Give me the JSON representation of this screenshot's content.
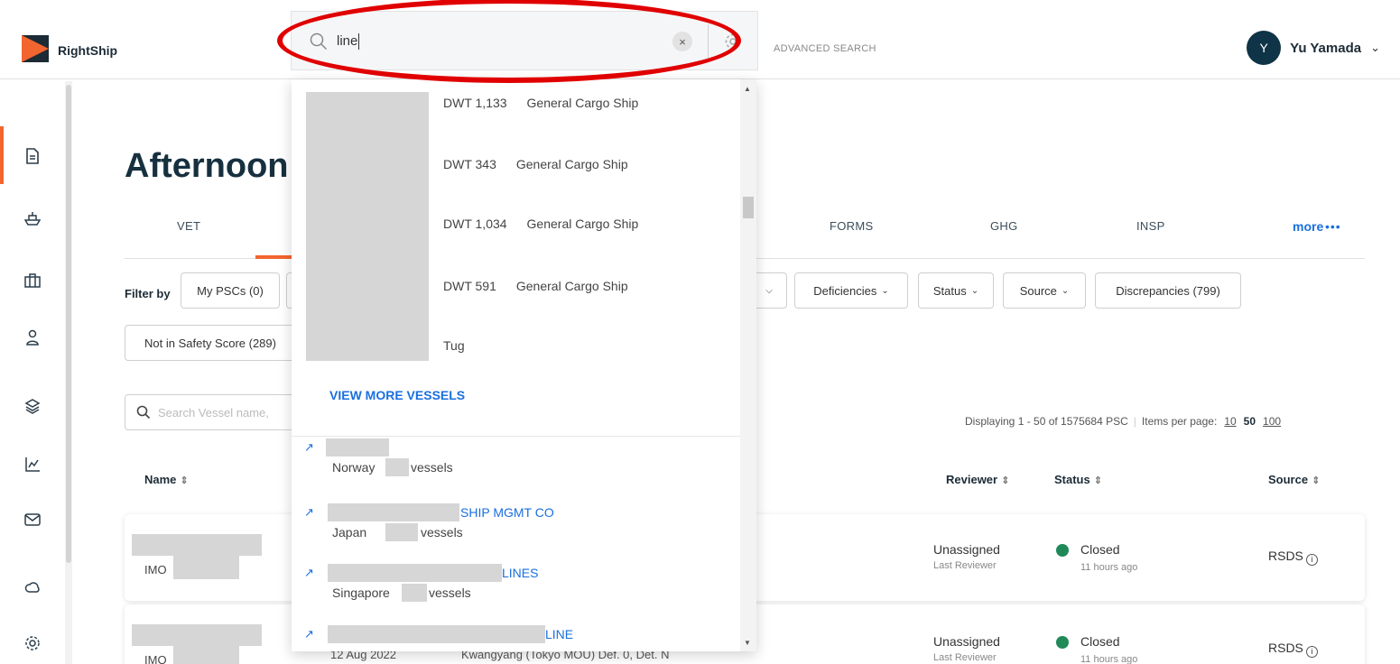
{
  "header": {
    "brand": "RightShip",
    "advanced_search": "ADVANCED SEARCH",
    "user": {
      "initial": "Y",
      "name": "Yu Yamada"
    }
  },
  "search": {
    "query": "line",
    "clear_symbol": "×"
  },
  "dropdown": {
    "vessels": [
      {
        "dwt": "DWT 1,133",
        "type": "General Cargo Ship"
      },
      {
        "dwt": "DWT 343",
        "type": "General Cargo Ship"
      },
      {
        "dwt": "DWT 1,034",
        "type": "General Cargo Ship"
      },
      {
        "dwt": "DWT 591",
        "type": "General Cargo Ship"
      },
      {
        "dwt": "",
        "type": "Tug"
      }
    ],
    "view_more": "VIEW MORE VESSELS",
    "companies": [
      {
        "name_suffix": "",
        "country": "Norway",
        "vessels_word": "vessels"
      },
      {
        "name_suffix": "SHIP MGMT CO",
        "country": "Japan",
        "vessels_word": "vessels"
      },
      {
        "name_suffix": "LINES",
        "country": "Singapore",
        "vessels_word": "vessels"
      },
      {
        "name_suffix": "LINE",
        "country": "",
        "vessels_word": ""
      }
    ]
  },
  "sidebar": {
    "icons": [
      "document-icon",
      "ship-icon",
      "briefcase-icon",
      "person-icon",
      "layers-icon",
      "chart-icon",
      "mail-icon",
      "cloud-icon",
      "settings-icon"
    ]
  },
  "page": {
    "greeting": "Afternoon",
    "tabs": [
      "VET",
      "FORMS",
      "GHG",
      "INSP"
    ],
    "more": "more",
    "more_dots": "•••",
    "filter_label": "Filter by",
    "filters": {
      "my_pscs": "My PSCs (0)",
      "deficiencies": "Deficiencies",
      "status": "Status",
      "source": "Source",
      "discrepancies": "Discrepancies (799)",
      "not_in_safety_score": "Not in Safety Score (289)"
    },
    "vessel_search_placeholder": "Search Vessel name,",
    "display_info": "Displaying 1 - 50 of 1575684 PSC",
    "items_per_page_label": "Items per page:",
    "items_per_page": [
      "10",
      "50",
      "100"
    ],
    "columns": {
      "name": "Name",
      "reviewer": "Reviewer",
      "status": "Status",
      "source": "Source"
    },
    "rows": [
      {
        "imo_prefix": "IMO",
        "date": "",
        "port": "",
        "reviewer": "Unassigned",
        "reviewer_sub": "Last Reviewer",
        "status": "Closed",
        "status_time": "11 hours ago",
        "source": "RSDS"
      },
      {
        "imo_prefix": "IMO",
        "date": "12 Aug 2022",
        "port": "Kwangyang (Tokyo MOU) Def. 0, Det. N",
        "reviewer": "Unassigned",
        "reviewer_sub": "Last Reviewer",
        "status": "Closed",
        "status_time": "11 hours ago",
        "source": "RSDS"
      }
    ]
  },
  "colors": {
    "accent": "#f2652f",
    "link": "#1a6fe0",
    "status_closed": "#1f8a57",
    "avatar": "#0f3347",
    "annotation": "#e00000"
  }
}
